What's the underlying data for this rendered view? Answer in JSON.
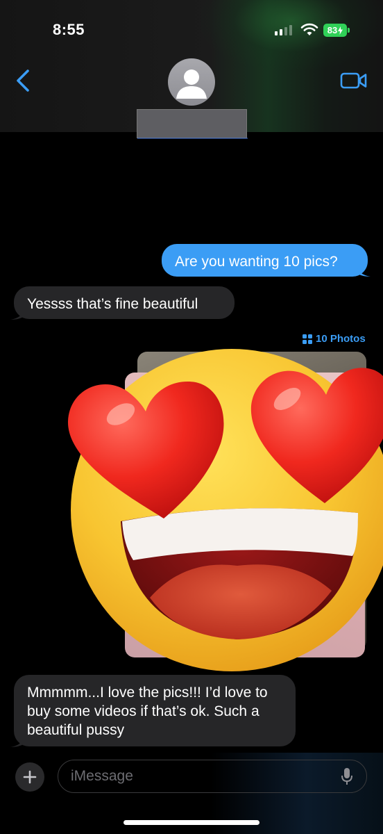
{
  "status_bar": {
    "time": "8:55",
    "battery": "83"
  },
  "header": {
    "contact_name": ""
  },
  "messages": [
    {
      "direction": "sent",
      "text": "Are you wanting 10 pics?"
    },
    {
      "direction": "received",
      "text": "Yessss that’s fine beautiful"
    },
    {
      "direction": "received",
      "text": "Mmmmm...I love the pics!!!  I’d love to buy some videos if that’s ok. Such a beautiful pussy"
    }
  ],
  "attachment": {
    "photos_label": "10 Photos"
  },
  "composer": {
    "placeholder": "iMessage"
  },
  "colors": {
    "accent": "#3b9df5",
    "sent_bubble": "#3b9df5",
    "received_bubble": "#262628",
    "battery": "#30d158"
  },
  "icons": {
    "back": "chevron-left-icon",
    "video": "video-camera-icon",
    "avatar": "person-icon",
    "photos": "grid-icon",
    "plus": "plus-icon",
    "mic": "microphone-icon",
    "sticker": "heart-eyes-emoji"
  }
}
